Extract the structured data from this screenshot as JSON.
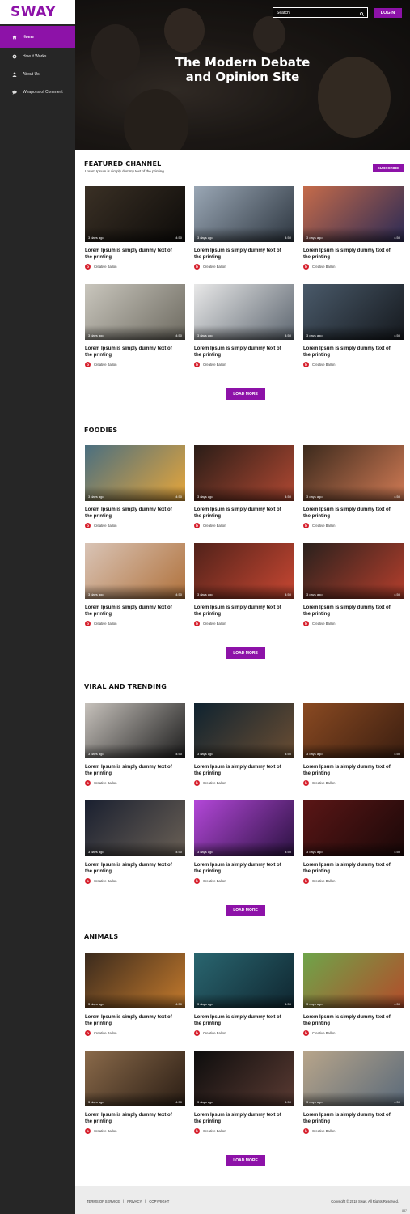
{
  "brand": {
    "logo": "SWAY",
    "accent": "#8d12a8"
  },
  "sidebar": {
    "items": [
      {
        "label": "Home",
        "icon": "home-icon",
        "active": true
      },
      {
        "label": "How it Works",
        "icon": "gear-icon",
        "active": false
      },
      {
        "label": "About Us",
        "icon": "user-icon",
        "active": false
      },
      {
        "label": "Weapons of Comment",
        "icon": "comment-icon",
        "active": false
      }
    ]
  },
  "header": {
    "search_placeholder": "Search",
    "login_label": "LOGIN",
    "hero_title_line1": "The Modern Debate",
    "hero_title_line2": "and Opinion Site"
  },
  "featured": {
    "title": "FEATURED CHANNEL",
    "subtitle": "Lorem Ipsum is simply dummy text of the printing",
    "subscribe_label": "SUBSCRIBE"
  },
  "card_defaults": {
    "age": "3 days ago",
    "duration": "4:50",
    "title": "Lorem Ipsum is simply dummy text of the printing",
    "author": "Creative Ballon",
    "avatar_letter": "b"
  },
  "sections": [
    {
      "title": "FEATURED CHANNEL",
      "load_more": "LOAD MORE",
      "thumbs": [
        "camera-rig",
        "photographer-beach",
        "lantern-sunset",
        "office-scene",
        "video-camera",
        "lens-closeup"
      ]
    },
    {
      "title": "FOODIES",
      "load_more": "LOAD MORE",
      "thumbs": [
        "soup-bowl",
        "sushi",
        "salmon",
        "granola",
        "crayfish",
        "seafood-pasta"
      ]
    },
    {
      "title": "VIRAL AND TRENDING",
      "load_more": "LOAD MORE",
      "thumbs": [
        "piano",
        "guitar",
        "banjo",
        "singer",
        "concert",
        "turntable"
      ]
    },
    {
      "title": "ANIMALS",
      "load_more": "LOAD MORE",
      "thumbs": [
        "tiger",
        "butterfly",
        "squirrel",
        "meerkat",
        "flamingo",
        "seagull"
      ]
    }
  ],
  "footer": {
    "links": [
      "TERMS OF SERVICE",
      "PRIVACY",
      "COPYRIGHT"
    ],
    "copyright": "Copyright © 2018 Sway. All Rights Reserved.",
    "version": "837"
  },
  "thumb_colors": {
    "camera-rig": [
      "#3a3025",
      "#0d0b09"
    ],
    "photographer-beach": [
      "#9aa7b5",
      "#2d3640"
    ],
    "lantern-sunset": [
      "#c56b4a",
      "#2b2a55"
    ],
    "office-scene": [
      "#c9c6bd",
      "#6d6a60"
    ],
    "video-camera": [
      "#e8e8e8",
      "#5d6670"
    ],
    "lens-closeup": [
      "#4a5a6a",
      "#15191e"
    ],
    "soup-bowl": [
      "#4a6f80",
      "#e7a63a"
    ],
    "sushi": [
      "#2a1d17",
      "#b04832"
    ],
    "salmon": [
      "#3c2a1d",
      "#d07a54"
    ],
    "granola": [
      "#d9c4b6",
      "#b0713b"
    ],
    "crayfish": [
      "#51221a",
      "#c84732"
    ],
    "seafood-pasta": [
      "#2a211d",
      "#b43e2c"
    ],
    "piano": [
      "#c7c2bc",
      "#1c1c1c"
    ],
    "guitar": [
      "#0f2330",
      "#6a4d32"
    ],
    "banjo": [
      "#8a4a22",
      "#3b1e10"
    ],
    "singer": [
      "#1a2030",
      "#6a6055"
    ],
    "concert": [
      "#b347d8",
      "#2a1240"
    ],
    "turntable": [
      "#5a1616",
      "#1a0808"
    ],
    "tiger": [
      "#3a2a1d",
      "#c47a2c"
    ],
    "butterfly": [
      "#2a6670",
      "#0f2630"
    ],
    "squirrel": [
      "#6ea54a",
      "#b34c2a"
    ],
    "meerkat": [
      "#8a6a4a",
      "#2a1d14"
    ],
    "flamingo": [
      "#0d0d0d",
      "#5a3a32"
    ],
    "seagull": [
      "#b8a58a",
      "#5a6a7a"
    ]
  }
}
